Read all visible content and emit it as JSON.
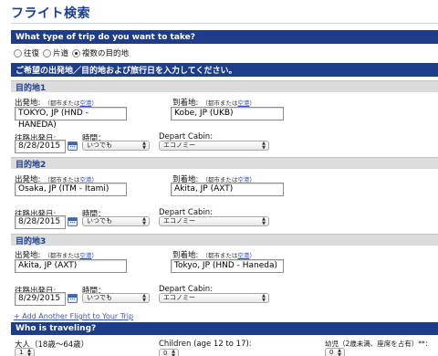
{
  "page_title": "フライト検索",
  "trip_type": {
    "heading": "What type of trip do you want to take?",
    "options": [
      "往復",
      "片道",
      "複数の目的地"
    ],
    "selected_index": 2
  },
  "instruction_bar": "ご希望の出発地／目的地および旅行日を入力してください。",
  "labels": {
    "origin": "出発地:",
    "destination": "到着地:",
    "city_or_airport": "（都市または",
    "airport_link": "空港",
    "close_paren": "）",
    "depart_date": "往路出発日:",
    "time": "時間：",
    "cabin": "Depart Cabin:"
  },
  "legs": [
    {
      "title": "目的地1",
      "origin": "TOKYO, JP (HND - HANEDA)",
      "destination": "Kobe, JP (UKB)",
      "date": "8/28/2015",
      "time": "いつでも",
      "cabin": "エコノミー"
    },
    {
      "title": "目的地2",
      "origin": "Osaka, JP (ITM - Itami)",
      "destination": "Akita, JP (AXT)",
      "date": "8/28/2015",
      "time": "いつでも",
      "cabin": "エコノミー"
    },
    {
      "title": "目的地3",
      "origin": "Akita, JP (AXT)",
      "destination": "Tokyo, JP (HND - Haneda)",
      "date": "8/29/2015",
      "time": "いつでも",
      "cabin": "エコノミー"
    }
  ],
  "add_flight_link": "+ Add Another Flight to Your Trip",
  "travelers": {
    "heading": "Who is traveling?",
    "adults_label": "大人（18歳〜64歳）",
    "adults_value": "1",
    "children_label": "Children (age 12 to 17):",
    "children_value": "0",
    "infants_label": "幼児（2歳未満、座席を占有）**：",
    "infants_value": "0"
  },
  "colors": {
    "header_blue": "#1d3d8a",
    "title_blue": "#1c3f8f",
    "link_blue": "#3355cc",
    "section_gray": "#dcdcdc"
  },
  "icons": {
    "calendar": "calendar-icon"
  }
}
